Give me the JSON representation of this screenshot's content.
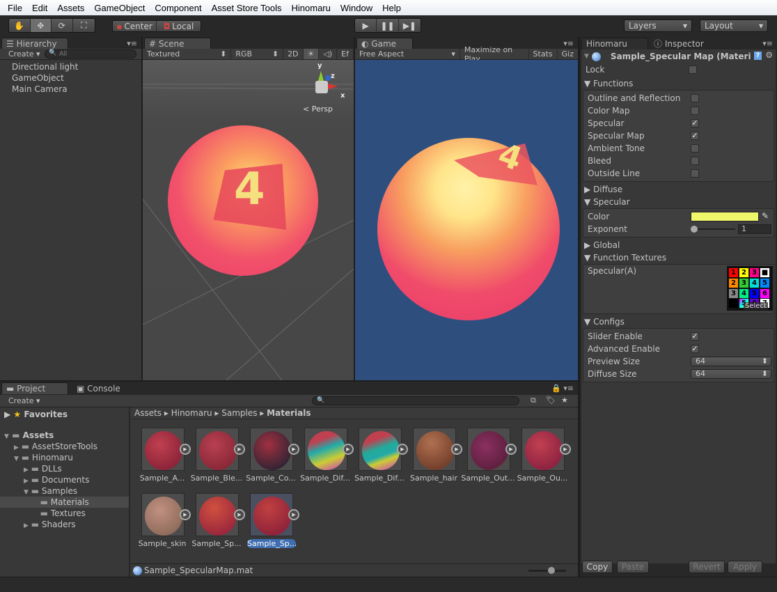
{
  "menu": [
    "File",
    "Edit",
    "Assets",
    "GameObject",
    "Component",
    "Asset Store Tools",
    "Hinomaru",
    "Window",
    "Help"
  ],
  "toolbar": {
    "pivot": "Center",
    "space": "Local",
    "layers": "Layers",
    "layout": "Layout"
  },
  "hierarchy": {
    "tab": "Hierarchy",
    "create": "Create",
    "search_placeholder": "All",
    "items": [
      "Directional light",
      "GameObject",
      "Main Camera"
    ]
  },
  "scene": {
    "tab": "Scene",
    "shading": "Textured",
    "channel": "RGB",
    "mode2d": "2D",
    "effects": "Ef",
    "persp": "Persp",
    "axes": {
      "x": "x",
      "y": "y",
      "z": "z"
    }
  },
  "game": {
    "tab": "Game",
    "aspect": "Free Aspect",
    "maximize": "Maximize on Play",
    "stats": "Stats",
    "gizmos": "Giz",
    "background": "#2e4f7e"
  },
  "inspector": {
    "tabs": [
      "Hinomaru",
      "Inspector"
    ],
    "title": "Sample_Specular Map (Materi",
    "lock": "Lock",
    "functions": {
      "label": "Functions",
      "items": [
        {
          "label": "Outline and Reflection",
          "checked": false
        },
        {
          "label": "Color Map",
          "checked": false
        },
        {
          "label": "Specular",
          "checked": true
        },
        {
          "label": "Specular Map",
          "checked": true
        },
        {
          "label": "Ambient Tone",
          "checked": false
        },
        {
          "label": "Bleed",
          "checked": false
        },
        {
          "label": "Outside Line",
          "checked": false
        }
      ]
    },
    "diffuse": "Diffuse",
    "specular": {
      "label": "Specular",
      "color_label": "Color",
      "color": "#eef86a",
      "exponent_label": "Exponent",
      "exponent": "1"
    },
    "global": "Global",
    "function_textures": {
      "label": "Function Textures",
      "slot": "Specular(A)",
      "select": "Select"
    },
    "configs": {
      "label": "Configs",
      "slider_enable": "Slider Enable",
      "slider_enable_checked": true,
      "advanced_enable": "Advanced Enable",
      "advanced_enable_checked": true,
      "preview_size": "Preview Size",
      "preview_size_value": "64",
      "diffuse_size": "Diffuse Size",
      "diffuse_size_value": "64"
    },
    "buttons": {
      "copy": "Copy",
      "paste": "Paste",
      "revert": "Revert",
      "apply": "Apply"
    }
  },
  "project": {
    "tabs": [
      "Project",
      "Console"
    ],
    "create": "Create",
    "favorites": "Favorites",
    "tree": [
      {
        "label": "Assets",
        "level": 0
      },
      {
        "label": "AssetStoreTools",
        "level": 1
      },
      {
        "label": "Hinomaru",
        "level": 1
      },
      {
        "label": "DLLs",
        "level": 2
      },
      {
        "label": "Documents",
        "level": 2
      },
      {
        "label": "Samples",
        "level": 2
      },
      {
        "label": "Materials",
        "level": 3
      },
      {
        "label": "Textures",
        "level": 3
      },
      {
        "label": "Shaders",
        "level": 2
      }
    ],
    "breadcrumb": [
      "Assets",
      "Hinomaru",
      "Samples",
      "Materials"
    ],
    "assets": [
      "Sample_A...",
      "Sample_Ble...",
      "Sample_Co...",
      "Sample_Dif...",
      "Sample_Dif...",
      "Sample_hair",
      "Sample_Out...",
      "Sample_Ou...",
      "Sample_skin",
      "Sample_Sp...",
      "Sample_Sp..."
    ],
    "selected_file": "Sample_SpecularMap.mat"
  }
}
